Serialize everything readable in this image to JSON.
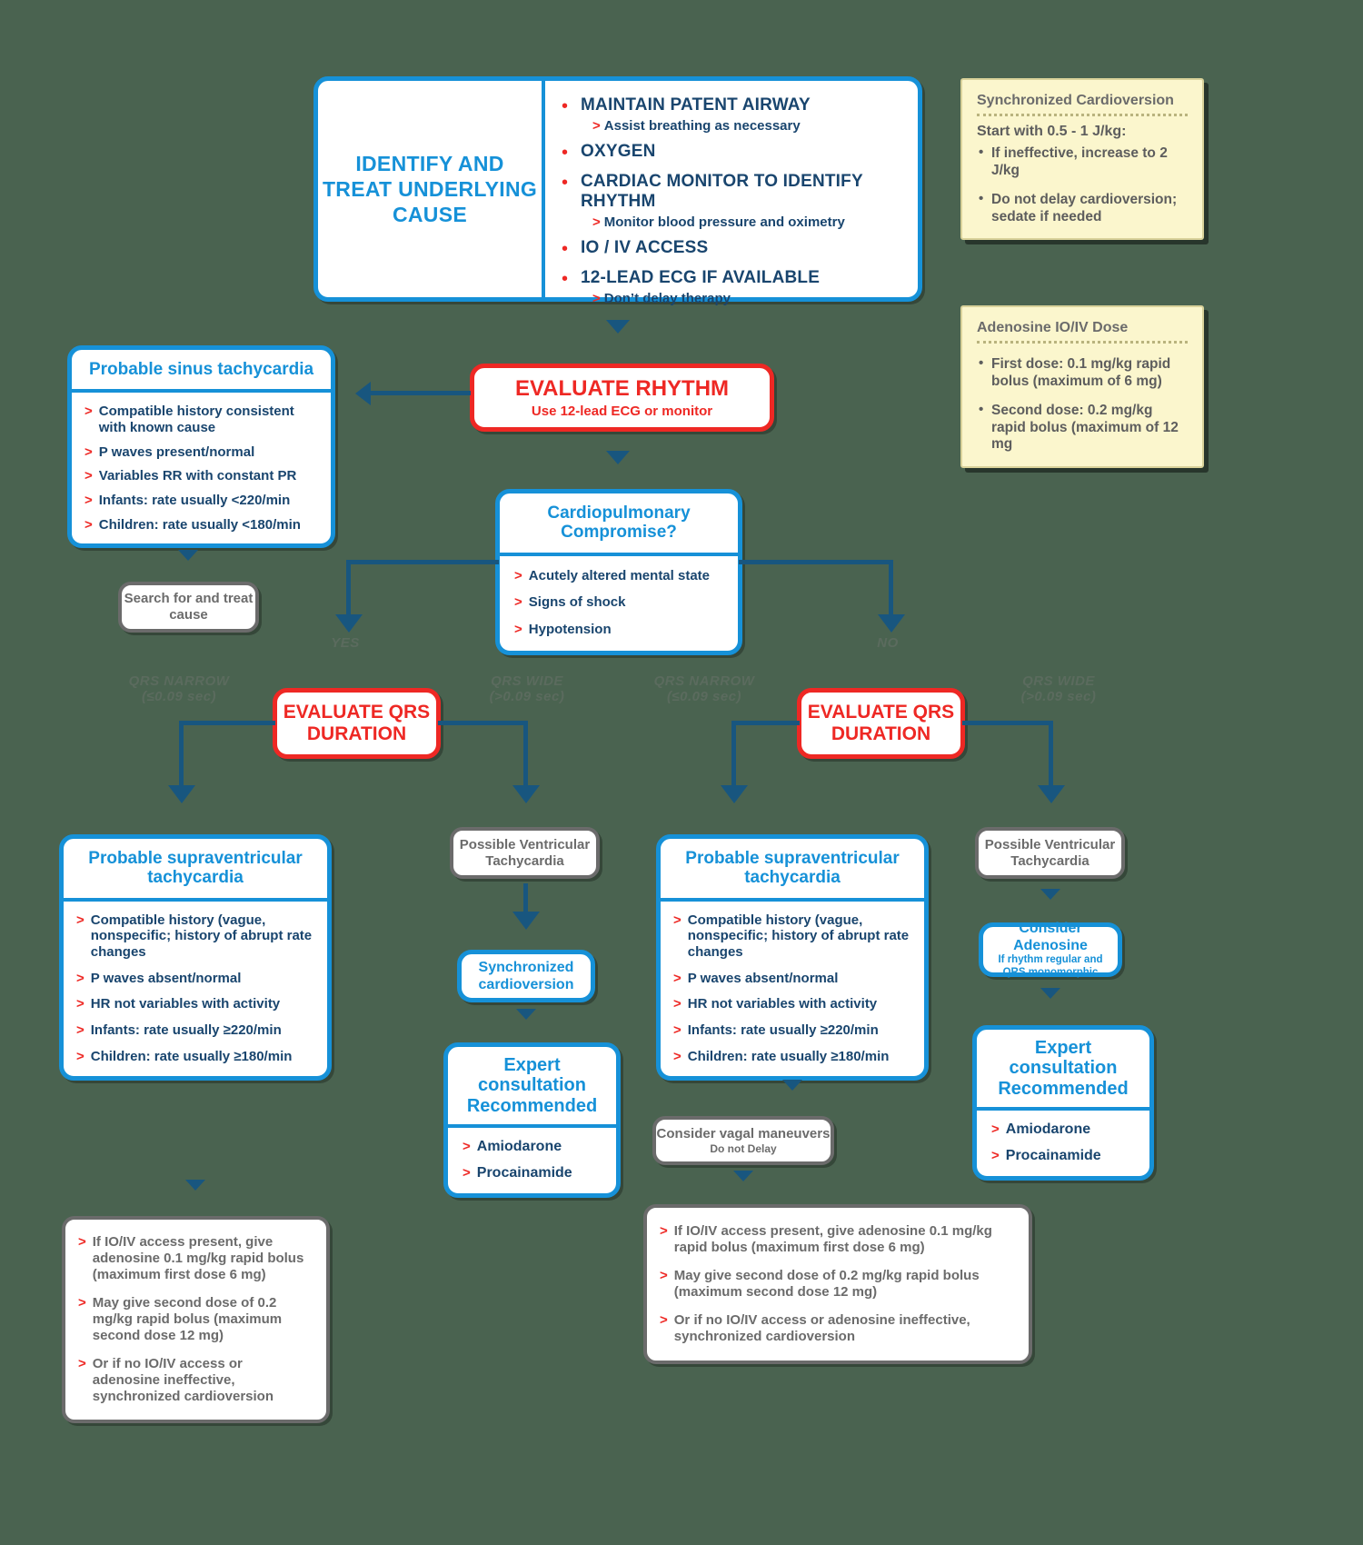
{
  "top_box": {
    "title": "IDENTIFY AND TREAT UNDERLYING CAUSE",
    "bullets": [
      {
        "label": "MAINTAIN PATENT AIRWAY",
        "sub": "Assist breathing as necessary"
      },
      {
        "label": "OXYGEN",
        "sub": ""
      },
      {
        "label": "CARDIAC MONITOR TO IDENTIFY RHYTHM",
        "sub": "Monitor blood pressure and oximetry"
      },
      {
        "label": "IO / IV ACCESS",
        "sub": ""
      },
      {
        "label": "12-LEAD ECG IF AVAILABLE",
        "sub": "Don’t delay therapy"
      }
    ]
  },
  "notes": [
    {
      "title": "Synchronized Cardioversion",
      "lead": "Start with 0.5 - 1 J/kg:",
      "items": [
        "If ineffective, increase to 2 J/kg",
        "Do not delay cardioversion; sedate if needed"
      ]
    },
    {
      "title": "Adenosine IO/IV Dose",
      "lead": "",
      "items": [
        "First dose: 0.1 mg/kg rapid bolus (maximum of 6 mg)",
        "Second dose: 0.2 mg/kg rapid bolus (maximum of 12 mg"
      ]
    }
  ],
  "evaluate_rhythm": {
    "title": "EVALUATE RHYTHM",
    "subtitle": "Use 12-lead ECG or monitor"
  },
  "sinus": {
    "title": "Probable sinus tachycardia",
    "items": [
      "Compatible history consistent with known cause",
      "P waves present/normal",
      "Variables RR with constant PR",
      "Infants: rate usually <220/min",
      "Children: rate usually <180/min"
    ]
  },
  "search_treat": "Search for and treat cause",
  "compromise": {
    "title": "Cardiopulmonary Compromise?",
    "items": [
      "Acutely altered mental state",
      "Signs of shock",
      "Hypotension"
    ]
  },
  "branch_labels": {
    "yes": "YES",
    "no": "NO",
    "qrs_narrow_1": "QRS NARROW",
    "qrs_narrow_1_sub": "(≤0.09 sec)",
    "qrs_wide_1": "QRS WIDE",
    "qrs_wide_1_sub": "(>0.09 sec)",
    "qrs_narrow_2": "QRS NARROW",
    "qrs_narrow_2_sub": "(≤0.09 sec)",
    "qrs_wide_2": "QRS WIDE",
    "qrs_wide_2_sub": "(>0.09 sec)"
  },
  "evaluate_qrs_left": "EVALUATE QRS DURATION",
  "evaluate_qrs_right": "EVALUATE QRS DURATION",
  "svt_left": {
    "title": "Probable supraventricular tachycardia",
    "items": [
      "Compatible history (vague, nonspecific; history of abrupt rate changes",
      "P waves absent/normal",
      "HR not variables with activity",
      "Infants: rate usually ≥220/min",
      "Children: rate usually ≥180/min"
    ]
  },
  "svt_right": {
    "title": "Probable supraventricular tachycardia",
    "items": [
      "Compatible history (vague, nonspecific; history of abrupt rate changes",
      "P waves absent/normal",
      "HR not variables with activity",
      "Infants: rate usually ≥220/min",
      "Children: rate usually ≥180/min"
    ]
  },
  "possible_vt_left": "Possible Ventricular Tachycardia",
  "possible_vt_right": "Possible Ventricular Tachycardia",
  "sync_cardioversion": "Synchronized cardioversion",
  "consider_adenosine": {
    "title": "Consider Adenosine",
    "sub1": "If rhythm regular and",
    "sub2": "QRS monomorphic"
  },
  "expert_mid": {
    "title": "Expert consultation Recommended",
    "items": [
      "Amiodarone",
      "Procainamide"
    ]
  },
  "expert_right": {
    "title": "Expert consultation Recommended",
    "items": [
      "Amiodarone",
      "Procainamide"
    ]
  },
  "vagal": {
    "title": "Consider vagal maneuvers",
    "sub": "Do not Delay"
  },
  "adenosine_left": [
    "If IO/IV access present, give adenosine 0.1 mg/kg rapid bolus (maximum first dose 6 mg)",
    "May give second dose of 0.2 mg/kg rapid bolus (maximum second dose 12 mg)",
    "Or if no IO/IV access or adenosine ineffective, synchronized cardioversion"
  ],
  "adenosine_right": [
    "If IO/IV access present, give adenosine 0.1 mg/kg rapid bolus (maximum first dose 6 mg)",
    "May give second dose of 0.2 mg/kg rapid bolus (maximum second dose 12 mg)",
    "Or if no IO/IV access or adenosine ineffective, synchronized cardioversion"
  ],
  "colors": {
    "blue": "#1691d8",
    "red": "#ee2824",
    "darkblue": "#19456e",
    "connector": "#18567f",
    "gray": "#6b6b6b",
    "note_bg": "#fbf6cd",
    "background": "#4a6350"
  }
}
